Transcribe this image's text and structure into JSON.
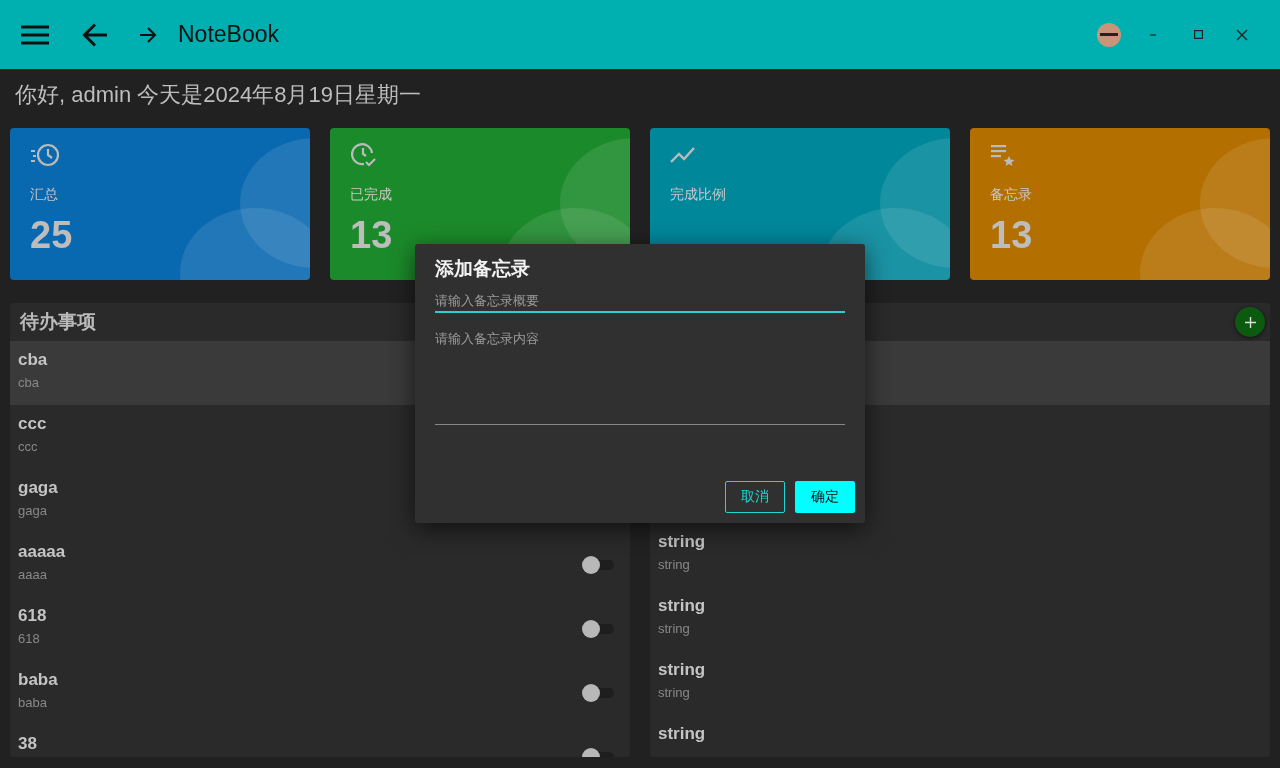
{
  "window": {
    "title": "NoteBook"
  },
  "greeting": "你好, admin 今天是2024年8月19日星期一",
  "cards": [
    {
      "kind": "history",
      "label": "汇总",
      "value": "25",
      "color": "#0868b0"
    },
    {
      "kind": "done",
      "label": "已完成",
      "value": "13",
      "color": "#1b8a2a"
    },
    {
      "kind": "trend",
      "label": "完成比例",
      "color": "#00879a"
    },
    {
      "kind": "memo",
      "label": "备忘录",
      "value": "13",
      "color": "#b36f00"
    }
  ],
  "todo_panel": {
    "title": "待办事项",
    "items": [
      {
        "title": "cba",
        "note": "cba",
        "selected": true
      },
      {
        "title": "ccc",
        "note": "ccc",
        "selected": false
      },
      {
        "title": "gaga",
        "note": "gaga",
        "selected": false
      },
      {
        "title": "aaaaa",
        "note": "aaaa",
        "selected": false,
        "done": false
      },
      {
        "title": "618",
        "note": "618",
        "selected": false,
        "done": false
      },
      {
        "title": "baba",
        "note": "baba",
        "selected": false,
        "done": false
      },
      {
        "title": "38",
        "selected": false,
        "done": false
      }
    ]
  },
  "memo_panel": {
    "items": [
      {
        "title": "string",
        "note": "string"
      },
      {
        "title": "string",
        "note": "string"
      },
      {
        "title": "string",
        "note": "string"
      },
      {
        "title": "string"
      }
    ]
  },
  "dialog": {
    "title": "添加备忘录",
    "summary_placeholder": "请输入备忘录概要",
    "content_placeholder": "请输入备忘录内容",
    "buttons": [
      {
        "kind": "outline",
        "label": "取消"
      },
      {
        "kind": "filled",
        "label": "确定"
      }
    ]
  }
}
